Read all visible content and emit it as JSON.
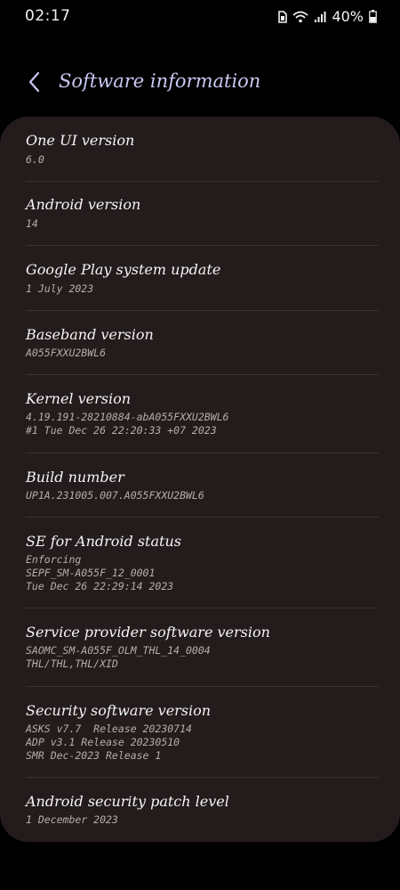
{
  "status_bar": {
    "time": "02:17",
    "battery": "40%"
  },
  "header": {
    "title": "Software information"
  },
  "items": [
    {
      "label": "One UI version",
      "values": [
        "6.0"
      ]
    },
    {
      "label": "Android version",
      "values": [
        "14"
      ]
    },
    {
      "label": "Google Play system update",
      "values": [
        "1 July 2023"
      ]
    },
    {
      "label": "Baseband version",
      "values": [
        "A055FXXU2BWL6"
      ]
    },
    {
      "label": "Kernel version",
      "values": [
        "4.19.191-28210884-abA055FXXU2BWL6",
        "#1 Tue Dec 26 22:20:33 +07 2023"
      ]
    },
    {
      "label": "Build number",
      "values": [
        "UP1A.231005.007.A055FXXU2BWL6"
      ]
    },
    {
      "label": "SE for Android status",
      "values": [
        "Enforcing",
        "SEPF_SM-A055F_12_0001",
        "Tue Dec 26 22:29:14 2023"
      ]
    },
    {
      "label": "Service provider software version",
      "values": [
        "SAOMC_SM-A055F_OLM_THL_14_0004",
        "THL/THL,THL/XID"
      ]
    },
    {
      "label": "Security software version",
      "values": [
        "ASKS v7.7  Release 20230714",
        "ADP v3.1 Release 20230510",
        "SMR Dec-2023 Release 1"
      ]
    },
    {
      "label": "Android security patch level",
      "values": [
        "1 December 2023"
      ]
    }
  ]
}
